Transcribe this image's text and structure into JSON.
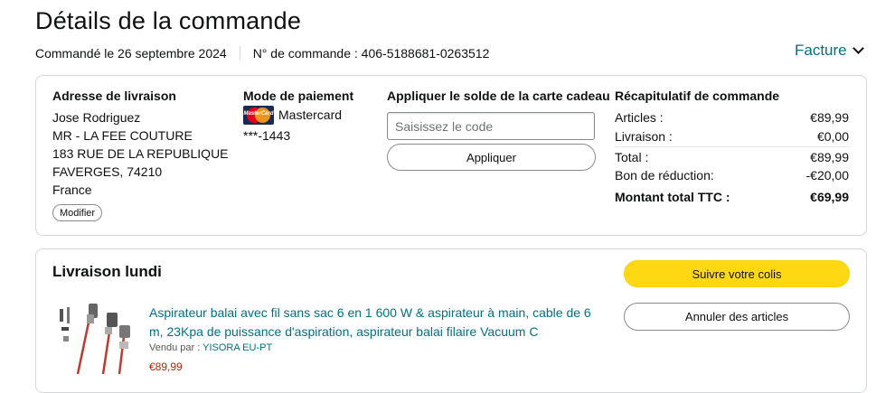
{
  "header": {
    "title": "Détails de la commande",
    "ordered_on": "Commandé le 26 septembre 2024",
    "order_number": "N° de commande : 406-5188681-0263512",
    "invoice_label": "Facture"
  },
  "shipping": {
    "title": "Adresse de livraison",
    "lines": [
      "Jose Rodriguez",
      "MR - LA FEE COUTURE",
      "183 RUE DE LA REPUBLIQUE",
      "FAVERGES, 74210",
      "France"
    ],
    "modify_label": "Modifier"
  },
  "payment": {
    "title": "Mode de paiement",
    "card_brand": "Mastercard",
    "card_logo_text": "MasterCard",
    "card_number": "***-1443"
  },
  "gift_card": {
    "title": "Appliquer le solde de la carte cadeau",
    "placeholder": "Saisissez le code",
    "apply_label": "Appliquer"
  },
  "summary": {
    "title": "Récapitulatif de commande",
    "rows": [
      {
        "label": "Articles :",
        "value": "€89,99"
      },
      {
        "label": "Livraison :",
        "value": "€0,00"
      },
      {
        "label": "Total :",
        "value": "€89,99"
      },
      {
        "label": "Bon de réduction:",
        "value": "-€20,00"
      },
      {
        "label": "Montant total TTC :",
        "value": "€69,99"
      }
    ]
  },
  "delivery": {
    "title": "Livraison lundi",
    "track_label": "Suivre votre colis",
    "cancel_label": "Annuler des articles",
    "item": {
      "title": "Aspirateur balai avec fil sans sac 6 en 1 600 W & aspirateur à main, cable de 6 m, 23Kpa de puissance d'aspiration, aspirateur balai filaire Vacuum C",
      "sold_by_label": "Vendu par :",
      "seller": "YISORA EU-PT",
      "price": "€89,99"
    }
  },
  "colors": {
    "link": "#007185",
    "price": "#b12704",
    "primary_button": "#ffd814",
    "border": "#d5d9d9"
  }
}
